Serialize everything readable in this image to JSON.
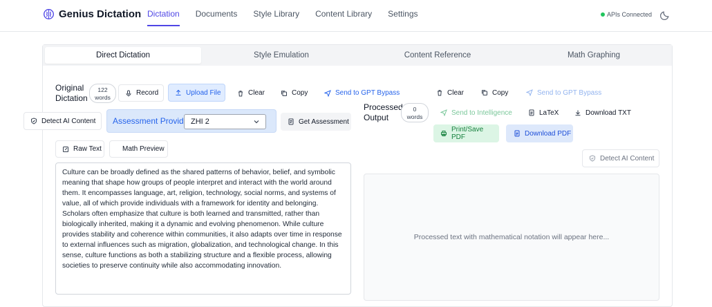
{
  "header": {
    "brand": "Genius Dictation",
    "nav": [
      {
        "label": "Dictation",
        "active": true
      },
      {
        "label": "Documents"
      },
      {
        "label": "Style Library"
      },
      {
        "label": "Content Library"
      },
      {
        "label": "Settings"
      }
    ],
    "status": "APIs Connected",
    "status_color": "#22c55e"
  },
  "tabs": [
    "Direct Dictation",
    "Style Emulation",
    "Content Reference",
    "Math Graphing"
  ],
  "left": {
    "title_line1": "Original",
    "title_line2": "Dictation",
    "word_count": "122",
    "word_unit": "words",
    "record": "Record",
    "upload": "Upload File",
    "clear": "Clear",
    "copy": "Copy",
    "send_gpt": "Send to GPT Bypass",
    "detect_ai": "Detect AI Content",
    "assessment_provider": "Assessment Provider:",
    "provider_value": "ZHI 2",
    "get_assessment": "Get Assessment",
    "raw_text": "Raw Text",
    "math_preview": "Math Preview",
    "text": "Culture can be broadly defined as the shared patterns of behavior, belief, and symbolic meaning that shape how groups of people interpret and interact with the world around them. It encompasses language, art, religion, technology, social norms, and systems of value, all of which provide individuals with a framework for identity and belonging. Scholars often emphasize that culture is both learned and transmitted, rather than biologically inherited, making it a dynamic and evolving phenomenon. While culture provides stability and coherence within communities, it also adapts over time in response to external influences such as migration, globalization, and technological change. In this sense, culture functions as both a stabilizing structure and a flexible process, allowing societies to preserve continuity while also accommodating innovation."
  },
  "right": {
    "clear": "Clear",
    "copy": "Copy",
    "send_gpt": "Send to GPT Bypass",
    "title_line1": "Processed",
    "title_line2": "Output",
    "word_count": "0",
    "word_unit": "words",
    "send_intelligence": "Send to Intelligence",
    "latex": "LaTeX",
    "download_txt": "Download TXT",
    "print_pdf": "Print/Save PDF",
    "download_pdf": "Download PDF",
    "detect_ai": "Detect AI Content",
    "placeholder": "Processed text with mathematical notation will appear here..."
  },
  "colors": {
    "accent": "#4f46e5",
    "link": "#2563eb",
    "success": "#15803d"
  }
}
